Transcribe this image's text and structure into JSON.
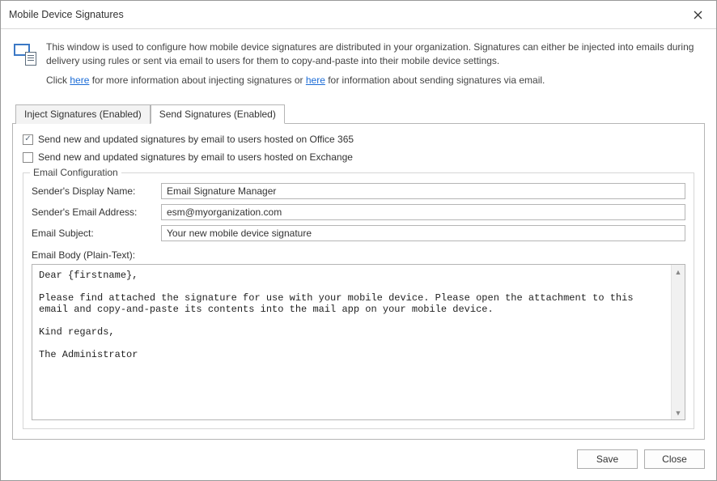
{
  "window": {
    "title": "Mobile Device Signatures"
  },
  "intro": {
    "paragraph1": "This window is used to configure how mobile device signatures are distributed in your organization. Signatures can either be injected into emails during delivery using rules or sent via email to users for them to copy-and-paste into their mobile device settings.",
    "p2_pre": "Click ",
    "p2_link1": "here",
    "p2_mid": " for more information about injecting signatures or ",
    "p2_link2": "here",
    "p2_post": " for information about sending signatures via email."
  },
  "tabs": {
    "inject": "Inject Signatures (Enabled)",
    "send": "Send Signatures (Enabled)"
  },
  "checkboxes": {
    "office365": {
      "checked": true,
      "label": "Send new and updated signatures by email to users hosted on Office 365"
    },
    "exchange": {
      "checked": false,
      "label": "Send new and updated signatures by email to users hosted on Exchange"
    }
  },
  "group": {
    "title": "Email Configuration"
  },
  "form": {
    "displayName": {
      "label": "Sender's Display Name:",
      "value": "Email Signature Manager"
    },
    "email": {
      "label": "Sender's Email Address:",
      "value": "esm@myorganization.com"
    },
    "subject": {
      "label": "Email Subject:",
      "value": "Your new mobile device signature"
    },
    "bodyLabel": "Email Body (Plain-Text):",
    "bodyText": "Dear {firstname},\n\nPlease find attached the signature for use with your mobile device. Please open the attachment to this email and copy-and-paste its contents into the mail app on your mobile device.\n\nKind regards,\n\nThe Administrator"
  },
  "buttons": {
    "save": "Save",
    "close": "Close"
  }
}
